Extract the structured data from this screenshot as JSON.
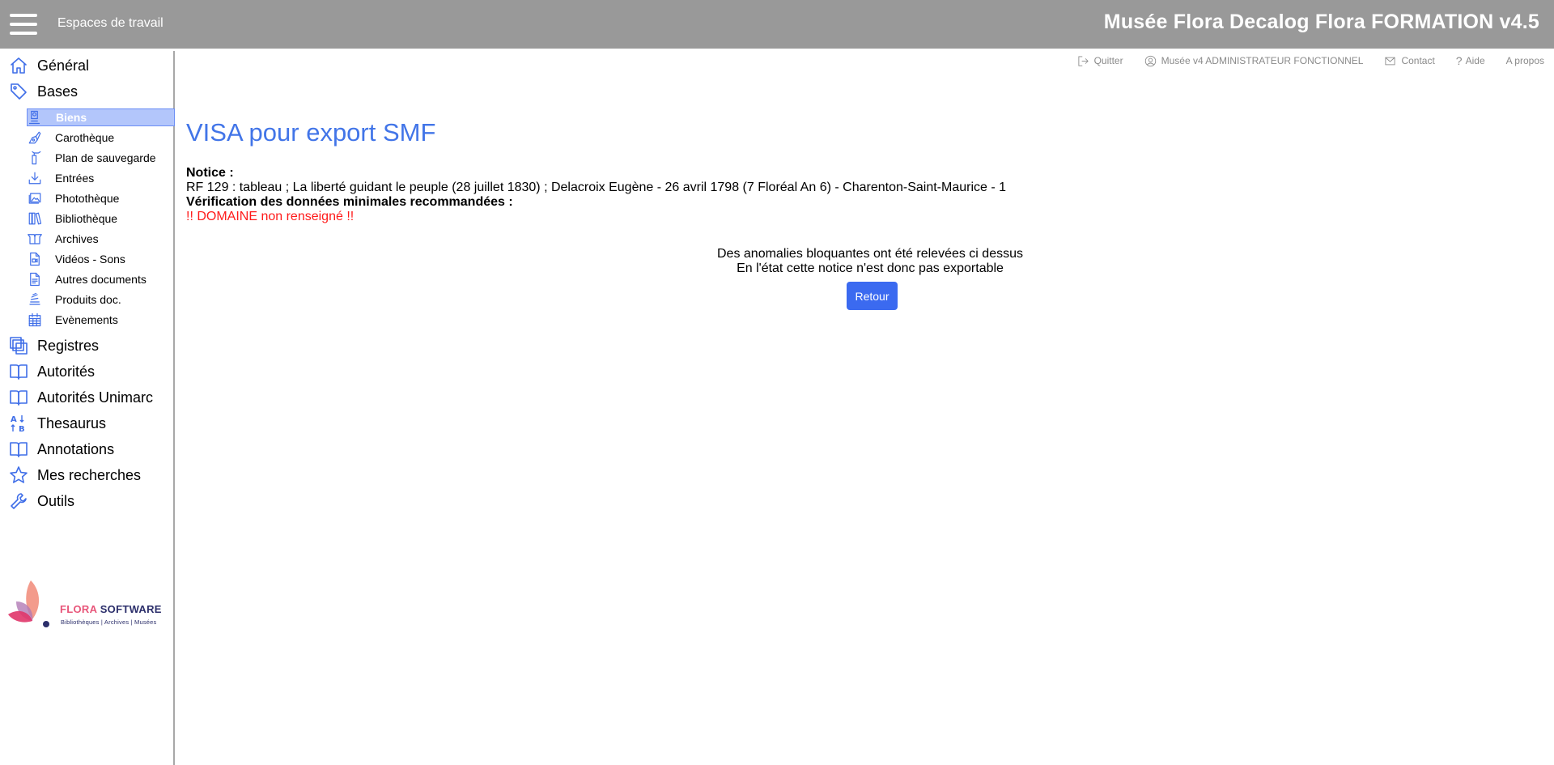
{
  "topbar": {
    "workspaces_label": "Espaces de travail",
    "app_title": "Musée Flora Decalog Flora FORMATION v4.5"
  },
  "toplinks": {
    "quit": "Quitter",
    "user": "Musée v4 ADMINISTRATEUR FONCTIONNEL",
    "contact": "Contact",
    "help": "Aide",
    "about": "A propos"
  },
  "sidebar": {
    "general": "Général",
    "bases": "Bases",
    "sub": {
      "biens": "Biens",
      "carotheque": "Carothèque",
      "plan": "Plan de sauvegarde",
      "entrees": "Entrées",
      "phototheque": "Photothèque",
      "bibliotheque": "Bibliothèque",
      "archives": "Archives",
      "videos": "Vidéos - Sons",
      "autres": "Autres documents",
      "produits": "Produits doc.",
      "evenements": "Evènements"
    },
    "registres": "Registres",
    "autorites": "Autorités",
    "autorites_unimarc": "Autorités Unimarc",
    "thesaurus": "Thesaurus",
    "annotations": "Annotations",
    "recherches": "Mes recherches",
    "outils": "Outils"
  },
  "logo": {
    "brand_hl": "FLORA",
    "brand_rest": " SOFTWARE",
    "tagline": "Bibliothèques | Archives | Musées"
  },
  "main": {
    "title": "VISA pour export SMF",
    "notice_label": "Notice :",
    "notice_text": "RF 129 : tableau ; La liberté guidant le peuple (28 juillet 1830) ; Delacroix Eugène - 26 avril 1798 (7 Floréal An 6) - Charenton-Saint-Maurice - 1",
    "verif_label": "Vérification des données minimales recommandées :",
    "error_text": "!! DOMAINE non renseigné !!",
    "msg_line1": "Des anomalies bloquantes ont été relevées ci dessus",
    "msg_line2": "En l'état cette notice n'est donc pas exportable",
    "back_button": "Retour"
  },
  "colors": {
    "topbar": "#999999",
    "accent": "#3f6ee8",
    "title": "#4275e8",
    "error": "#ff1a1a",
    "active_bg": "#b3c6fb"
  }
}
